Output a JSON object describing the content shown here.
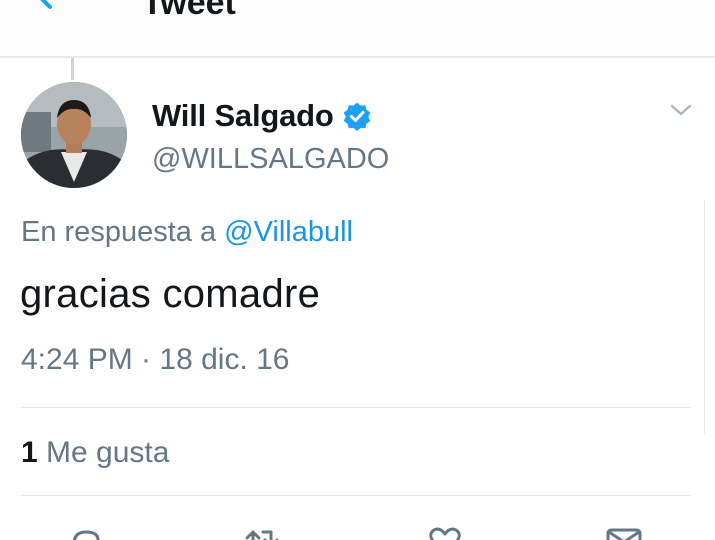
{
  "header": {
    "title": "Tweet",
    "back_icon": "back-arrow-icon"
  },
  "tweet": {
    "author": {
      "display_name": "Will Salgado",
      "handle": "@WILLSALGADO",
      "verified": true,
      "verified_color": "#1da1f2"
    },
    "reply_to_prefix": "En respuesta a",
    "reply_to_handle": "@Villabull",
    "text": "gracias comadre",
    "timestamp": "4:24 PM · 18 dic. 16",
    "likes_count": "1",
    "likes_label": "Me gusta"
  },
  "actions": [
    {
      "name": "reply",
      "icon": "reply-icon"
    },
    {
      "name": "retweet",
      "icon": "retweet-icon"
    },
    {
      "name": "like",
      "icon": "heart-icon"
    },
    {
      "name": "direct-message",
      "icon": "envelope-icon"
    }
  ],
  "colors": {
    "text_primary": "#14171a",
    "text_secondary": "#657786",
    "link": "#1b95e0",
    "divider": "#e1e8ed"
  }
}
